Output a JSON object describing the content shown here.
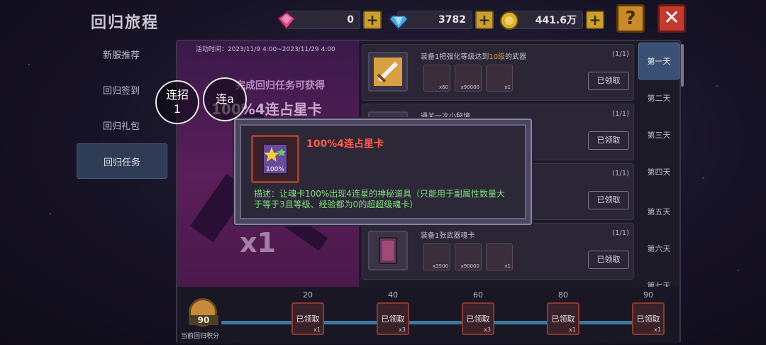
{
  "title": "回归旅程",
  "currency": [
    {
      "icon": "pink-gem-icon",
      "value": "0",
      "color": "#d94a8a"
    },
    {
      "icon": "blue-diamond-icon",
      "value": "3782",
      "color": "#4aa8e8"
    },
    {
      "icon": "gold-coin-icon",
      "value": "441.6万",
      "color": "#d8b030"
    }
  ],
  "help_icon": "question-icon",
  "close_icon": "close-icon",
  "nav": [
    {
      "label": "新服推荐",
      "active": false
    },
    {
      "label": "回归签到",
      "active": false
    },
    {
      "label": "回归礼包",
      "active": false
    },
    {
      "label": "回归任务",
      "active": true
    }
  ],
  "banner": {
    "time": "活动时间：2023/11/9 4:00~2023/11/29 4:00",
    "subtitle": "完成回归任务可获得",
    "headline": "100%4连占星卡",
    "multiplier": "x1"
  },
  "tasks": [
    {
      "desc_pre": "装备1把强化等级达到",
      "desc_hl": "10级",
      "desc_post": "的武器",
      "count": "(1/1)",
      "rewards": [
        "x60",
        "x90000",
        "x1"
      ],
      "button": "已领取"
    },
    {
      "desc_pre": "通关一次小秘境",
      "desc_hl": "",
      "desc_post": "",
      "count": "(1/1)",
      "rewards": [],
      "button": "已领取"
    },
    {
      "desc_pre": "",
      "desc_hl": "",
      "desc_post": "",
      "count": "(1/1)",
      "rewards": [],
      "button": "已领取"
    },
    {
      "desc_pre": "装备1张武器魂卡",
      "desc_hl": "",
      "desc_post": "",
      "count": "(1/1)",
      "rewards": [
        "x3500",
        "x90000",
        "x1"
      ],
      "button": "已领取"
    }
  ],
  "days": [
    "第一天",
    "第二天",
    "第三天",
    "第四天",
    "第五天",
    "第六天",
    "第七天"
  ],
  "progress": {
    "current": "90",
    "caption": "当前回归积分",
    "value_fraction": 1.0,
    "milestones": [
      {
        "points": "20",
        "label": "已领取",
        "qty": "x1"
      },
      {
        "points": "40",
        "label": "已领取",
        "qty": "x3"
      },
      {
        "points": "60",
        "label": "已领取",
        "qty": "x3"
      },
      {
        "points": "80",
        "label": "已领取",
        "qty": "x1"
      },
      {
        "points": "90",
        "label": "已领取",
        "qty": "x1"
      }
    ]
  },
  "tooltip": {
    "name": "100%4连占星卡",
    "icon_text": "100%",
    "description": "描述：让魂卡100%出现4连星的神秘道具（只能用于副属性数量大于等于3且等级、经验都为0的超超级魂卡）"
  },
  "overlay": [
    {
      "line1": "连招",
      "line2": "1"
    },
    {
      "line1": "连a",
      "line2": ""
    }
  ]
}
